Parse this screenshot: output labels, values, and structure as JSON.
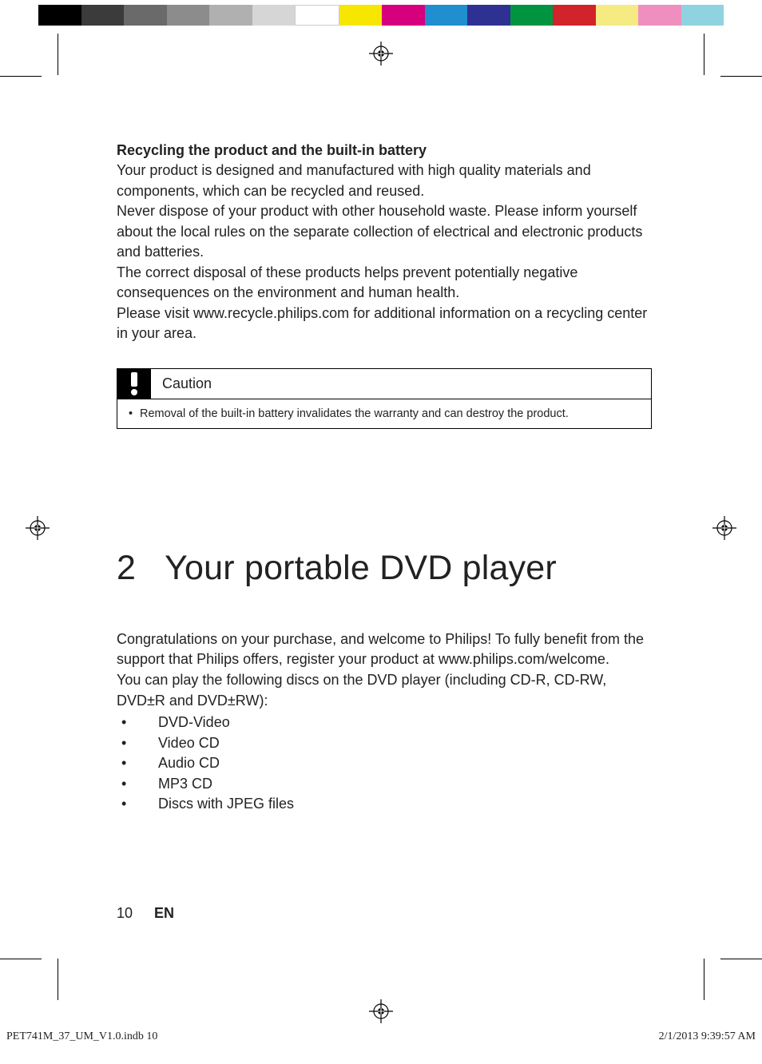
{
  "colorbar": [
    "#000000",
    "#3b3b3b",
    "#6a6a6a",
    "#8c8c8c",
    "#b0b0b0",
    "#d6d6d6",
    "#ffffff",
    "#f7e600",
    "#d6007e",
    "#1f8fcf",
    "#2e3192",
    "#009440",
    "#d2232a",
    "#f6ea82",
    "#ef8fbf",
    "#8fd3e0"
  ],
  "recycle": {
    "heading": "Recycling the product and the built-in battery",
    "p1": "Your product is designed and manufactured with high quality materials and components, which can be recycled and reused.",
    "p2": "Never dispose of your product with other household waste. Please inform yourself about the local rules on the separate collection of electrical and electronic products and batteries.",
    "p3": "The correct disposal of these products helps prevent potentially negative consequences on the environment and human health.",
    "p4": "Please visit www.recycle.philips.com for additional information on a recycling center in your area."
  },
  "caution": {
    "label": "Caution",
    "item": "Removal of the built-in battery invalidates the warranty and can destroy the product."
  },
  "section2": {
    "num": "2",
    "title": "Your portable DVD player",
    "p1": "Congratulations on your purchase, and welcome to Philips! To fully benefit from the support that Philips offers, register your product at www.philips.com/welcome.",
    "p2": "You can play the following discs on the DVD player (including CD-R, CD-RW, DVD±R and DVD±RW):",
    "discs": [
      "DVD-Video",
      "Video CD",
      "Audio CD",
      "MP3 CD",
      "Discs with JPEG files"
    ]
  },
  "footer": {
    "page": "10",
    "lang": "EN"
  },
  "imprint": {
    "left": "PET741M_37_UM_V1.0.indb   10",
    "right": "2/1/2013   9:39:57 AM"
  }
}
